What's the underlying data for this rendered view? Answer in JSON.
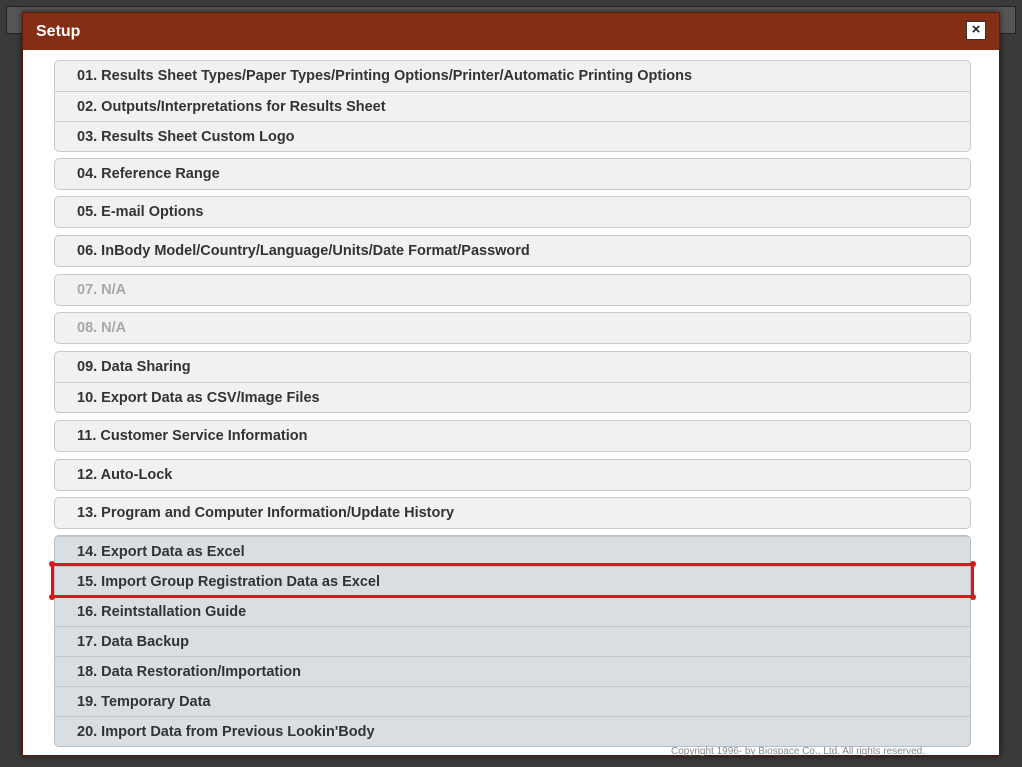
{
  "dialog": {
    "title": "Setup",
    "close_label": "×",
    "copyright": "Copyright 1996- by Biospace Co., Ltd. All rights reserved."
  },
  "groups": [
    {
      "style": "light",
      "items": [
        {
          "label": "01. Results Sheet Types/Paper Types/Printing Options/Printer/Automatic Printing Options",
          "disabled": false
        },
        {
          "label": "02. Outputs/Interpretations for Results Sheet",
          "disabled": false
        },
        {
          "label": "03. Results Sheet Custom Logo",
          "disabled": false
        }
      ]
    },
    {
      "style": "light",
      "items": [
        {
          "label": "04. Reference Range",
          "disabled": false
        }
      ]
    },
    {
      "style": "light",
      "items": [
        {
          "label": "05. E-mail Options",
          "disabled": false
        }
      ]
    },
    {
      "style": "light",
      "items": [
        {
          "label": "06. InBody Model/Country/Language/Units/Date Format/Password",
          "disabled": false
        }
      ]
    },
    {
      "style": "light",
      "items": [
        {
          "label": "07. N/A",
          "disabled": true
        }
      ]
    },
    {
      "style": "light",
      "items": [
        {
          "label": "08. N/A",
          "disabled": true
        }
      ]
    },
    {
      "style": "light",
      "items": [
        {
          "label": "09. Data Sharing",
          "disabled": false
        },
        {
          "label": "10. Export Data as CSV/Image Files",
          "disabled": false
        }
      ]
    },
    {
      "style": "light",
      "items": [
        {
          "label": "11. Customer Service Information",
          "disabled": false
        }
      ]
    },
    {
      "style": "light",
      "items": [
        {
          "label": "12. Auto-Lock",
          "disabled": false
        }
      ]
    },
    {
      "style": "light",
      "items": [
        {
          "label": "13. Program and Computer Information/Update History",
          "disabled": false
        }
      ]
    },
    {
      "style": "dark",
      "items": [
        {
          "label": "14. Export Data as Excel",
          "disabled": false
        },
        {
          "label": "15. Import Group Registration Data as Excel",
          "disabled": false
        },
        {
          "label": "16. Reintstallation Guide",
          "disabled": false
        },
        {
          "label": "17. Data Backup",
          "disabled": false
        },
        {
          "label": "18. Data Restoration/Importation",
          "disabled": false
        },
        {
          "label": "19. Temporary Data",
          "disabled": false
        },
        {
          "label": "20. Import Data from Previous Lookin'Body",
          "disabled": false
        }
      ]
    }
  ]
}
